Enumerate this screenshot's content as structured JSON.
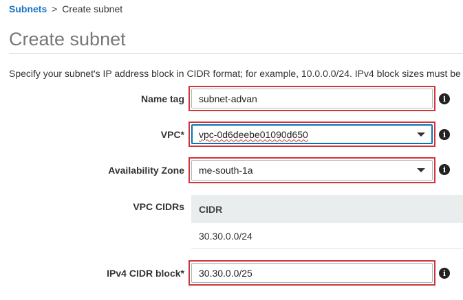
{
  "breadcrumb": {
    "parent": "Subnets",
    "separator": ">",
    "current": "Create subnet"
  },
  "page": {
    "title": "Create subnet",
    "description": "Specify your subnet's IP address block in CIDR format; for example, 10.0.0.0/24. IPv4 block sizes must be"
  },
  "form": {
    "name_tag": {
      "label": "Name tag",
      "value": "subnet-advan"
    },
    "vpc": {
      "label": "VPC*",
      "value": "vpc-0d6deebe01090d650"
    },
    "availability_zone": {
      "label": "Availability Zone",
      "value": "me-south-1a"
    },
    "vpc_cidrs": {
      "label": "VPC CIDRs",
      "columns": [
        "CIDR"
      ],
      "rows": [
        "30.30.0.0/24"
      ]
    },
    "ipv4_cidr_block": {
      "label": "IPv4 CIDR block*",
      "value": "30.30.0.0/25"
    }
  },
  "icons": {
    "info": "i"
  },
  "colors": {
    "link": "#1a73c8",
    "highlight_border": "#d13438",
    "focus_border": "#0073bb",
    "table_header_bg": "#eaeded",
    "title": "#777777"
  }
}
